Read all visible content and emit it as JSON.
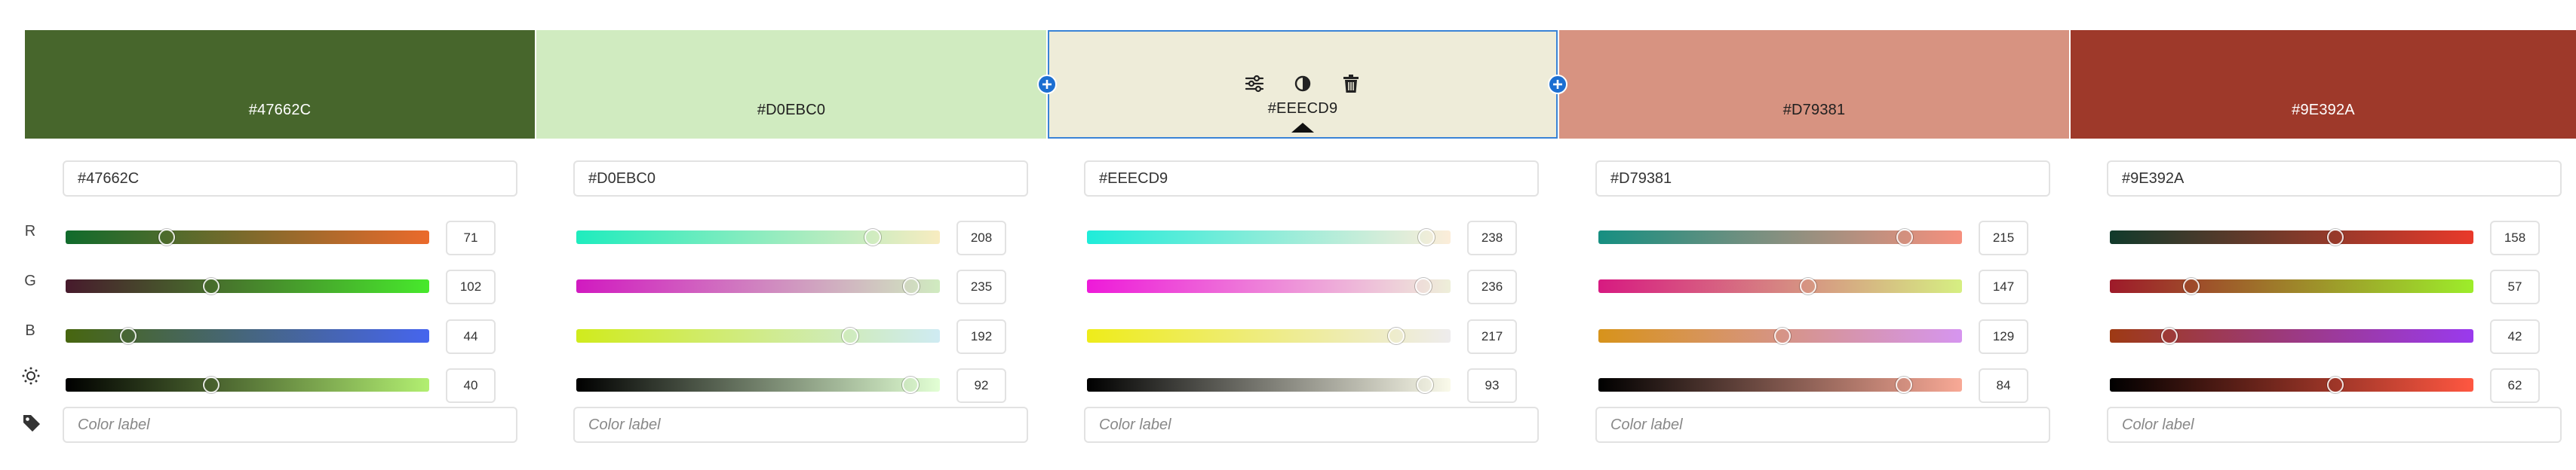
{
  "swatches": [
    {
      "hex": "#47662C",
      "color": "#47662C",
      "text_color": "#ffffff",
      "active": false
    },
    {
      "hex": "#D0EBC0",
      "color": "#D0EBC0",
      "text_color": "#1f1f1f",
      "active": false
    },
    {
      "hex": "#EEECD9",
      "color": "#EEECD9",
      "text_color": "#1f1f1f",
      "active": true
    },
    {
      "hex": "#D79381",
      "color": "#D79381",
      "text_color": "#1f1f1f",
      "active": false
    },
    {
      "hex": "#9E392A",
      "color": "#9E392A",
      "text_color": "#ffffff",
      "active": false
    }
  ],
  "swatch_tools": [
    "sliders-icon",
    "contrast-icon",
    "trash-icon"
  ],
  "row_labels": {
    "r": "R",
    "g": "G",
    "b": "B",
    "brightness": "brightness-icon",
    "label": "tag-icon"
  },
  "label_placeholder": "Color label",
  "columns": [
    {
      "hex": "#47662C",
      "r": 71,
      "g": 102,
      "b": 44,
      "brightness": 40,
      "gradients": {
        "r": [
          "#106b2c",
          "#eb6a2c"
        ],
        "g": [
          "#471a2c",
          "#47e92c"
        ],
        "b": [
          "#47660f",
          "#4665ee"
        ],
        "brightness": [
          "#000000",
          "#b2ef71"
        ]
      }
    },
    {
      "hex": "#D0EBC0",
      "r": 208,
      "g": 235,
      "b": 192,
      "brightness": 92,
      "gradients": {
        "r": [
          "#1fecbe",
          "#f8ecc0"
        ],
        "g": [
          "#d11ac0",
          "#d0ebc0"
        ],
        "b": [
          "#d0eb1d",
          "#cfebf3"
        ],
        "brightness": [
          "#000000",
          "#e2ffd4"
        ]
      }
    },
    {
      "hex": "#EEECD9",
      "r": 238,
      "g": 236,
      "b": 217,
      "brightness": 93,
      "gradients": {
        "r": [
          "#1fecd9",
          "#fcedd9"
        ],
        "g": [
          "#ee1ad9",
          "#eeefd9"
        ],
        "b": [
          "#eeec1a",
          "#eeeced"
        ],
        "brightness": [
          "#000000",
          "#fafaea"
        ]
      }
    },
    {
      "hex": "#D79381",
      "r": 215,
      "g": 147,
      "b": 129,
      "brightness": 84,
      "gradients": {
        "r": [
          "#168f81",
          "#f6907e"
        ],
        "g": [
          "#d71a81",
          "#d6ef82"
        ],
        "b": [
          "#d7931b",
          "#d695ef"
        ],
        "brightness": [
          "#000000",
          "#f8a996"
        ]
      }
    },
    {
      "hex": "#9E392A",
      "r": 158,
      "g": 57,
      "b": 42,
      "brightness": 62,
      "gradients": {
        "r": [
          "#113a2b",
          "#e9392a"
        ],
        "g": [
          "#9e1a2a",
          "#9ded2a"
        ],
        "b": [
          "#9e3a14",
          "#9a3aee"
        ],
        "brightness": [
          "#000000",
          "#ff5741"
        ]
      }
    }
  ],
  "slider_max": {
    "r": 255,
    "g": 255,
    "b": 255,
    "brightness": 100
  }
}
